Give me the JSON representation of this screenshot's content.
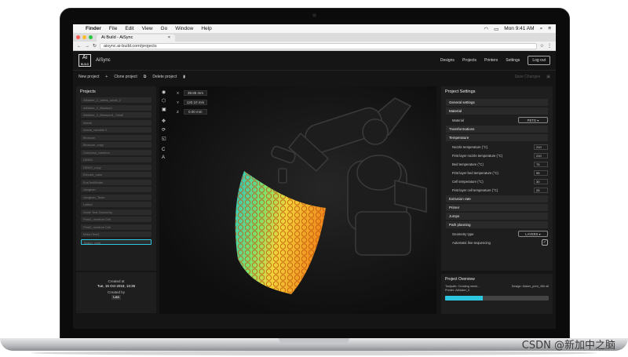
{
  "menubar": {
    "apple": "",
    "app": "Finder",
    "items": [
      "File",
      "Edit",
      "View",
      "Go",
      "Window",
      "Help"
    ],
    "clock": "Mon 9:41 AM"
  },
  "browser": {
    "tab_title": "Ai Build - AiSync",
    "url": "aisync.ai-build.com/projects"
  },
  "app": {
    "logo_top": "Ai",
    "logo_bottom": "BUILD",
    "name": "AiSync",
    "nav": [
      "Designs",
      "Projects",
      "Printers",
      "Settings"
    ],
    "logout": "Log out"
  },
  "toolbar": {
    "new": "New project",
    "clone": "Clone project",
    "delete": "Delete project",
    "save": "Save Changes"
  },
  "projects": {
    "title": "Projects",
    "items": [
      "AiMaker_2_saltos_small_2",
      "AiMaker_2_Blossom",
      "AiMaker_2_Blossom1_Small",
      "Armat",
      "Armat_variable 2",
      "Blossom",
      "Blossom_copy",
      "Company_bamboo",
      "DEMO",
      "DEMO_copy",
      "Elevant_case",
      "EusTestModel",
      "Vaughan",
      "Vaughan_Tests",
      "Lattice",
      "Scale Test Geometry",
      "Print1_medium Cell",
      "Print2_medium Cell",
      "MakerTest1",
      "Maker_print"
    ],
    "selected_index": 19
  },
  "created": {
    "at_label": "Created at",
    "at_value": "Tue, 15 Oct 2019, 13:36",
    "by_label": "Created by",
    "by_value": "Lea"
  },
  "coords": {
    "x_label": "X",
    "x_value": "38.85 mm",
    "y_label": "Y",
    "y_value": "120.10 mm",
    "z_label": "Z",
    "z_value": "0.00 mm"
  },
  "settings": {
    "title": "Project Settings",
    "general": "General settings",
    "material_sec": "Material",
    "material_label": "Material",
    "material_value": "PETG",
    "transformations": "Transformations",
    "temperature": "Temperature",
    "temps": [
      {
        "label": "Nozzle temperature (°C)",
        "value": "210"
      },
      {
        "label": "First layer nozzle temperature (°C)",
        "value": "210"
      },
      {
        "label": "Bed temperature (°C)",
        "value": "75"
      },
      {
        "label": "First layer bed temperature (°C)",
        "value": "95"
      },
      {
        "label": "Cell temperature (°C)",
        "value": "30"
      },
      {
        "label": "First layer cell temperature (°C)",
        "value": "25"
      }
    ],
    "extrusion": "Extrusion rate",
    "primer": "Primer",
    "jumps": "Jumps",
    "path": "Path planning",
    "geometry_label": "Geometry type",
    "geometry_value": "LAYERS",
    "auto_label": "Automatic line sequencing",
    "auto_check": "✓"
  },
  "overview": {
    "title": "Project Overview",
    "toolpath": "Toolpath: Creating mesh...",
    "design": "Design: Maker_print_450.stl",
    "printer": "Printer: AiMaker_0",
    "progress": 0.36
  },
  "watermark": "CSDN @新加中之脑",
  "colors": {
    "accent": "#2ec7e0"
  }
}
